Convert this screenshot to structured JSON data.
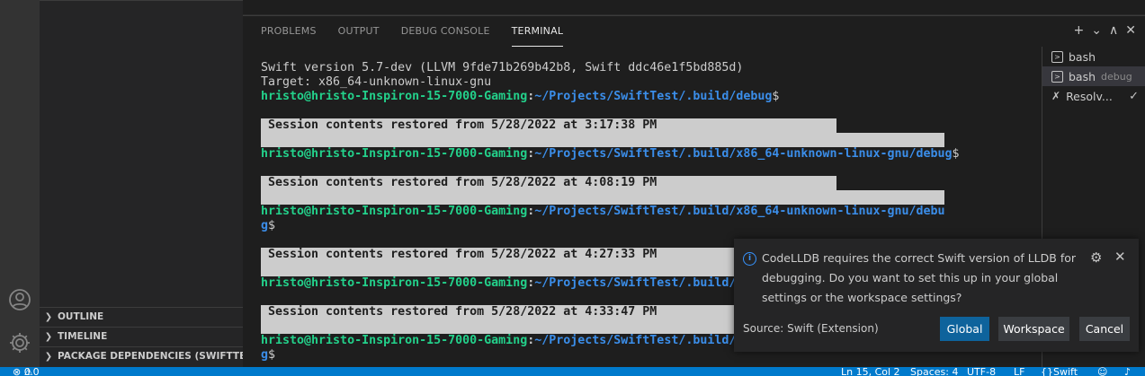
{
  "sidebar": {
    "sections": [
      {
        "label": "OUTLINE"
      },
      {
        "label": "TIMELINE"
      },
      {
        "label": "PACKAGE DEPENDENCIES (SWIFTTE..."
      }
    ]
  },
  "panel": {
    "tabs": [
      {
        "label": "PROBLEMS"
      },
      {
        "label": "OUTPUT"
      },
      {
        "label": "DEBUG CONSOLE"
      },
      {
        "label": "TERMINAL"
      }
    ],
    "actions": [
      "+",
      "⌄",
      "∧",
      "✕"
    ]
  },
  "terminal": {
    "line1": "Swift version 5.7-dev (LLVM 9fde71b269b42b8, Swift ddc46e1f5bd885d)",
    "line2": "Target: x86_64-unknown-linux-gnu",
    "user": "hristo@hristo-Inspiron-15-7000-Gaming",
    "colon": ":",
    "path1": "~/Projects/SwiftTest/.build/debug",
    "dollar": "$",
    "restore1": " Session contents restored from 5/28/2022 at 3:17:38 PM",
    "path2": "~/Projects/SwiftTest/.build/x86_64-unknown-linux-gnu/debug",
    "restore2": " Session contents restored from 5/28/2022 at 4:08:19 PM",
    "path3a": "~/Projects/SwiftTest/.build/x86_64-unknown-linux-gnu/debu",
    "path3b": "g",
    "restore3": " Session contents restored from 5/28/2022 at 4:27:33 PM",
    "path4": "~/Projects/SwiftTest/.build/",
    "restore4": " Session contents restored from 5/28/2022 at 4:33:47 PM",
    "path5a": "~/Projects/SwiftTest/.build/",
    "path5b": "g"
  },
  "terminal_list": [
    {
      "name": "bash",
      "tag": ""
    },
    {
      "name": "bash",
      "tag": "debug"
    },
    {
      "name": "Resolv...",
      "tag": ""
    }
  ],
  "notification": {
    "message": "CodeLLDB requires the correct Swift version of LLDB for debugging. Do you want to set this up in your global settings or the workspace settings?",
    "source": "Source: Swift (Extension)",
    "buttons": {
      "global": "Global",
      "workspace": "Workspace",
      "cancel": "Cancel"
    }
  },
  "statusbar": {
    "problems": "0",
    "warnings": "0",
    "position": "Ln 15, Col 2",
    "spaces": "Spaces: 4",
    "encoding": "UTF-8",
    "eol": "LF",
    "language": "Swift"
  },
  "colors": {
    "accent": "#007acc",
    "primary_button": "#0e639c",
    "prompt_user": "#23d18b",
    "prompt_path": "#3b8eea"
  }
}
